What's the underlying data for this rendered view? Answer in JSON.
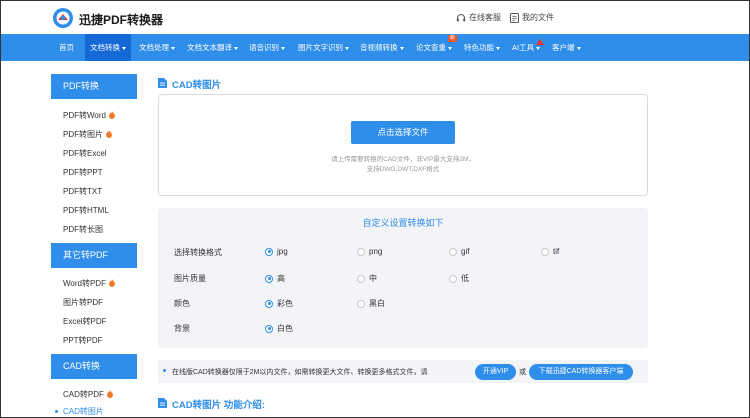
{
  "header": {
    "logo_text": "迅捷PDF转换器",
    "service_label": "在线客服",
    "my_files_label": "我的文件"
  },
  "nav": {
    "items": [
      {
        "label": "首页"
      },
      {
        "label": "文档转换"
      },
      {
        "label": "文档处理"
      },
      {
        "label": "文档文本翻译"
      },
      {
        "label": "语音识别"
      },
      {
        "label": "图片文字识别"
      },
      {
        "label": "音视频转换"
      },
      {
        "label": "论文查重"
      },
      {
        "label": "特色功能"
      },
      {
        "label": "AI工具"
      },
      {
        "label": "客户端"
      }
    ],
    "badge_label": "新"
  },
  "sidebar": {
    "groups": [
      {
        "title": "PDF转换",
        "items": [
          "PDF转Word",
          "PDF转图片",
          "PDF转Excel",
          "PDF转PPT",
          "PDF转TXT",
          "PDF转HTML",
          "PDF转长图"
        ]
      },
      {
        "title": "其它转PDF",
        "items": [
          "Word转PDF",
          "图片转PDF",
          "Excel转PDF",
          "PPT转PDF"
        ]
      },
      {
        "title": "CAD转换",
        "items": [
          "CAD转PDF",
          "CAD转图片"
        ]
      }
    ]
  },
  "main": {
    "title": "CAD转图片",
    "choose_button": "点击选择文件",
    "hint_line1": "请上传需要转换的CAD文件，非VIP最大支持2M，",
    "hint_line2": "支持DWG,DWT,DXF格式",
    "settings_title": "自定义设置转换如下",
    "rows": [
      {
        "label": "选择转换格式",
        "options": [
          "jpg",
          "png",
          "gif",
          "tif"
        ],
        "selected": "jpg"
      },
      {
        "label": "图片质量",
        "options": [
          "高",
          "中",
          "低"
        ],
        "selected": "高"
      },
      {
        "label": "颜色",
        "options": [
          "彩色",
          "黑白"
        ],
        "selected": "彩色"
      },
      {
        "label": "背景",
        "options": [
          "白色"
        ],
        "selected": "白色"
      }
    ],
    "notice_text": "在线版CAD转换器仅限于2M以内文件，如需转换更大文件、转换更多格式文件，请",
    "vip_button": "开通VIP",
    "or_text": "或",
    "download_button": "下载迅捷CAD转换器客户端",
    "intro_title": "CAD转图片 功能介绍:"
  },
  "colors": {
    "accent": "#2f8eea",
    "nav_active": "#1469d6",
    "badge": "#f25a2a",
    "hot": "#f07a28"
  }
}
